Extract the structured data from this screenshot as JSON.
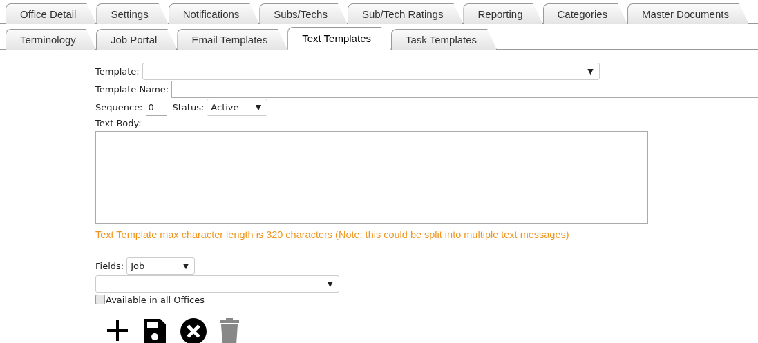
{
  "tab_rows": [
    {
      "tabs": [
        {
          "label": "Office Detail",
          "selected": false
        },
        {
          "label": "Settings",
          "selected": false
        },
        {
          "label": "Notifications",
          "selected": false
        },
        {
          "label": "Subs/Techs",
          "selected": false
        },
        {
          "label": "Sub/Tech Ratings",
          "selected": false
        },
        {
          "label": "Reporting",
          "selected": false
        },
        {
          "label": "Categories",
          "selected": false
        },
        {
          "label": "Master Documents",
          "selected": false
        }
      ]
    },
    {
      "tabs": [
        {
          "label": "Terminology",
          "selected": false
        },
        {
          "label": "Job Portal",
          "selected": false
        },
        {
          "label": "Email Templates",
          "selected": false
        },
        {
          "label": "Text Templates",
          "selected": true
        },
        {
          "label": "Task Templates",
          "selected": false
        }
      ]
    }
  ],
  "form": {
    "template_label": "Template:",
    "template_name_label": "Template Name:",
    "sequence_label": "Sequence:",
    "sequence_value": "0",
    "status_label": "Status:",
    "status_value": "Active",
    "text_body_label": "Text Body:",
    "note": "Text Template max character length is 320 characters (Note: this could be split into multiple text messages)",
    "fields_label": "Fields:",
    "fields_value": "Job",
    "available_label": "Available in all Offices",
    "available_checked": false,
    "dropdown_arrow": "▼"
  },
  "actions": [
    {
      "kind": "add",
      "disabled": false
    },
    {
      "kind": "save",
      "disabled": false
    },
    {
      "kind": "cancel",
      "disabled": false
    },
    {
      "kind": "delete",
      "disabled": true
    }
  ]
}
